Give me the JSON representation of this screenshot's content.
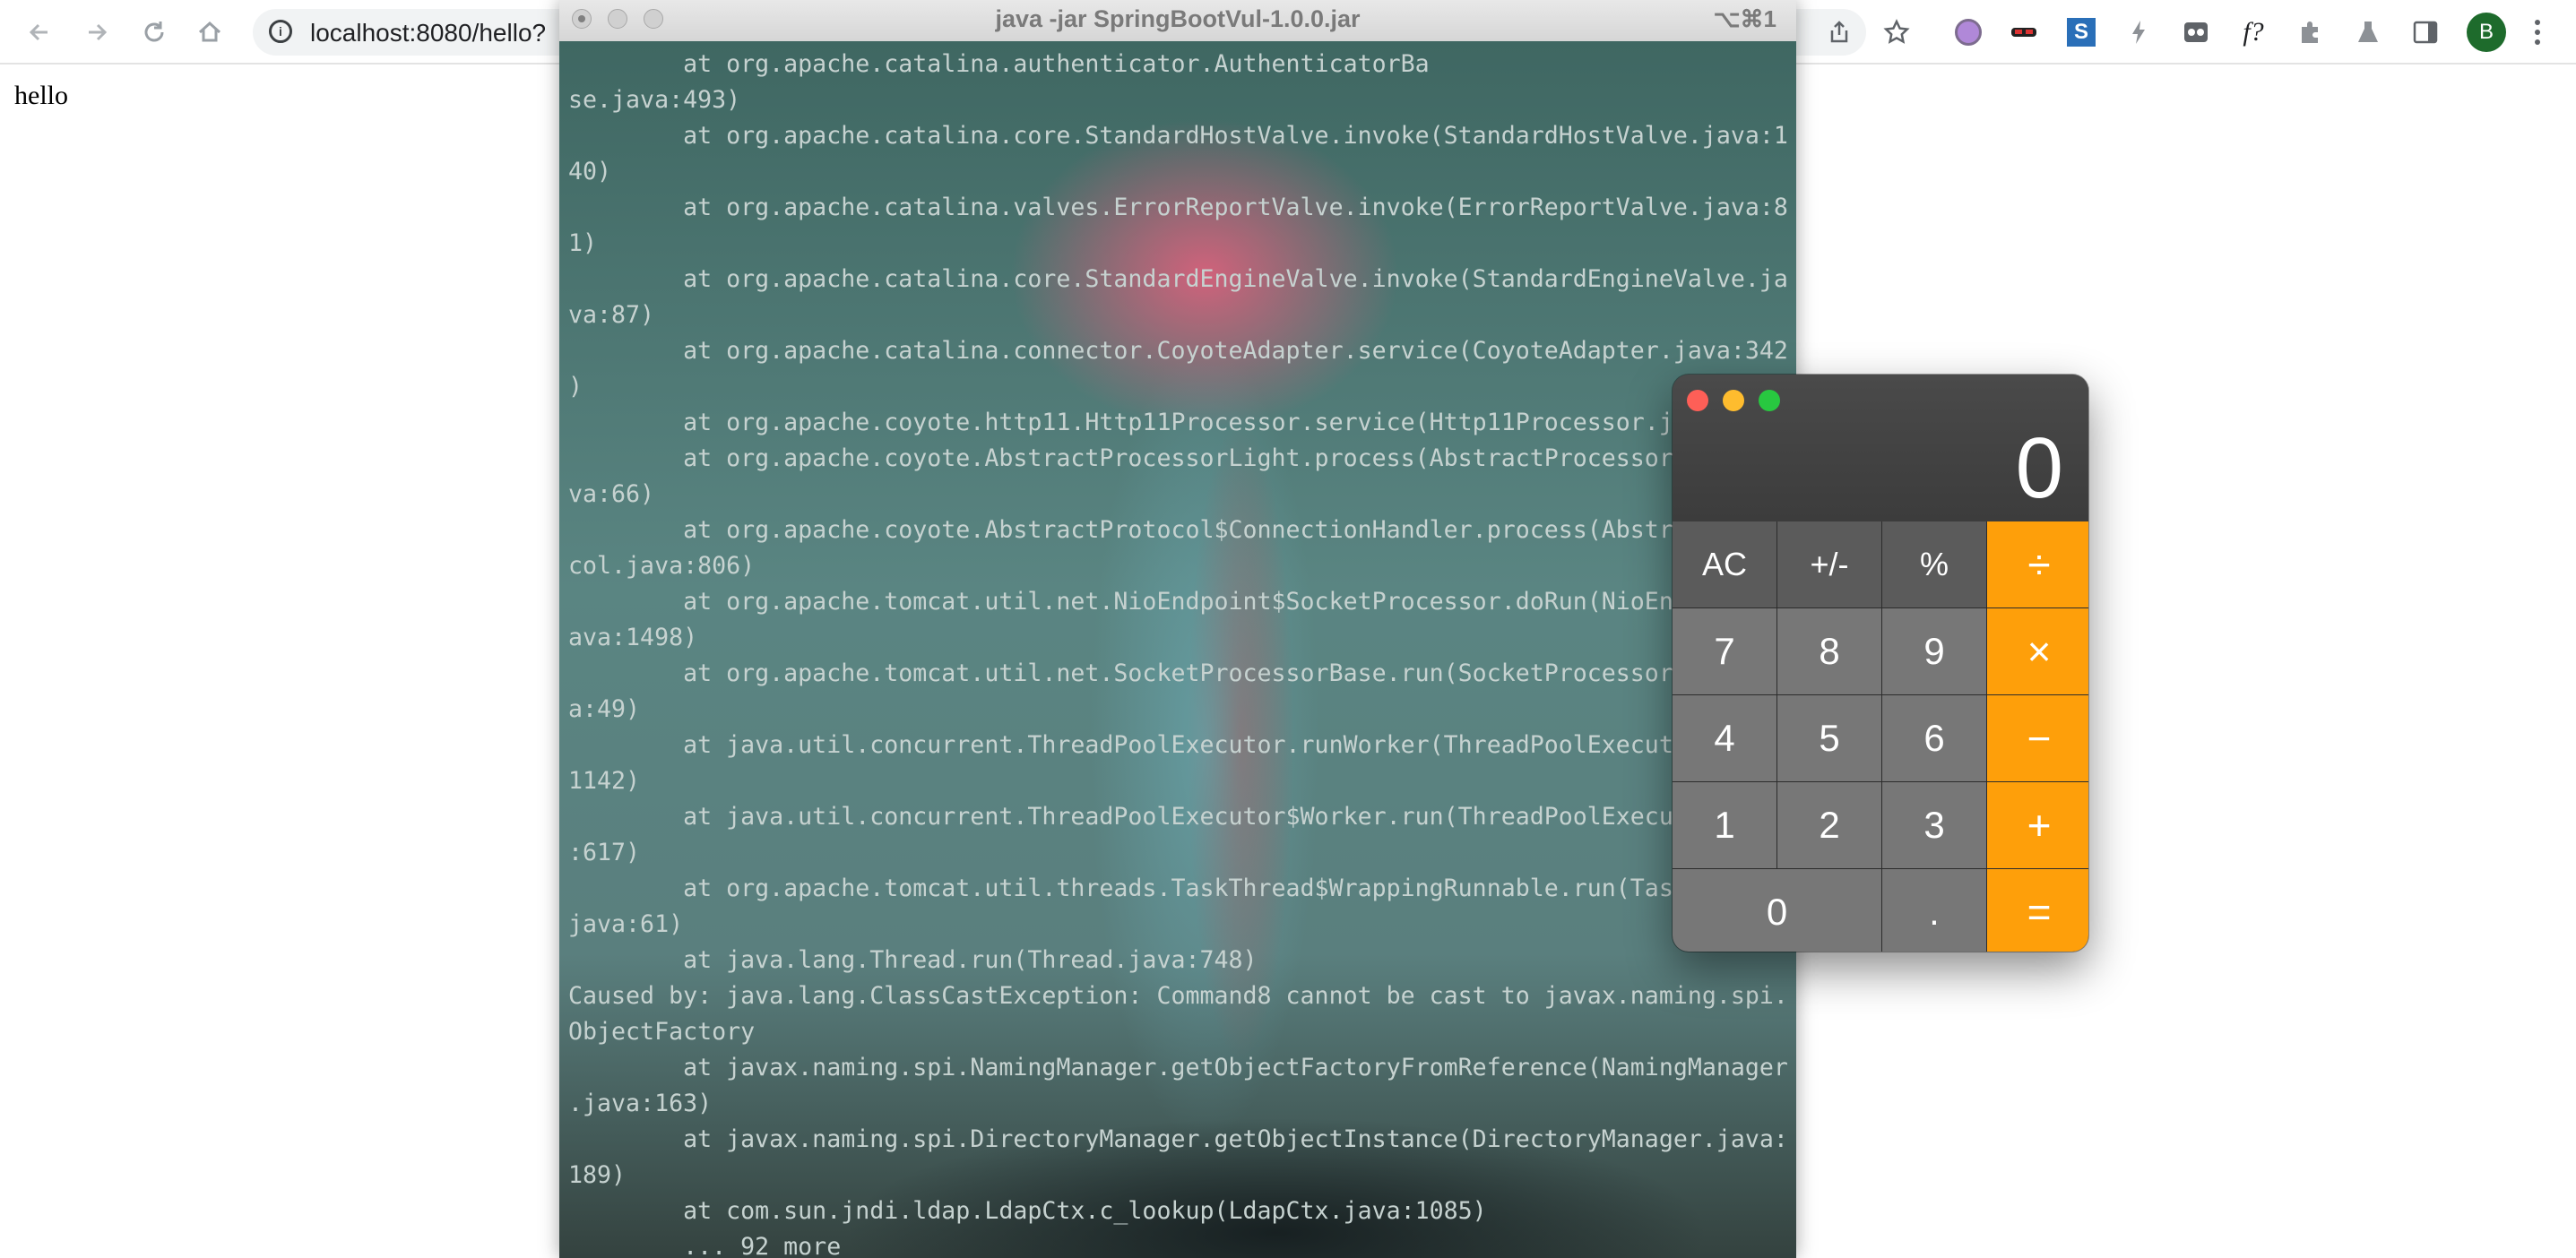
{
  "browser": {
    "url": "localhost:8080/hello?",
    "back_icon": "back-arrow",
    "forward_icon": "forward-arrow",
    "reload_icon": "reload",
    "home_icon": "home",
    "profile_initial": "B",
    "ext_f_label": "f?"
  },
  "page": {
    "text": "hello"
  },
  "terminal": {
    "title": "java -jar SpringBootVul-1.0.0.jar",
    "shortcut": "⌥⌘1",
    "lines": [
      "        at org.apache.catalina.authenticator.AuthenticatorBa",
      "se.java:493)",
      "        at org.apache.catalina.core.StandardHostValve.invoke(StandardHostValve.java:1",
      "40)",
      "        at org.apache.catalina.valves.ErrorReportValve.invoke(ErrorReportValve.java:8",
      "1)",
      "        at org.apache.catalina.core.StandardEngineValve.invoke(StandardEngineValve.ja",
      "va:87)",
      "        at org.apache.catalina.connector.CoyoteAdapter.service(CoyoteAdapter.java:342",
      ")",
      "        at org.apache.coyote.http11.Http11Processor.service(Http11Processor.j",
      "        at org.apache.coyote.AbstractProcessorLight.process(AbstractProcessor",
      "va:66)",
      "        at org.apache.coyote.AbstractProtocol$ConnectionHandler.process(Abstr",
      "col.java:806)",
      "        at org.apache.tomcat.util.net.NioEndpoint$SocketProcessor.doRun(NioEn",
      "ava:1498)",
      "        at org.apache.tomcat.util.net.SocketProcessorBase.run(SocketProcessor",
      "a:49)",
      "        at java.util.concurrent.ThreadPoolExecutor.runWorker(ThreadPoolExecut",
      "1142)",
      "        at java.util.concurrent.ThreadPoolExecutor$Worker.run(ThreadPoolExecu",
      ":617)",
      "        at org.apache.tomcat.util.threads.TaskThread$WrappingRunnable.run(Tas",
      "java:61)",
      "        at java.lang.Thread.run(Thread.java:748)",
      "Caused by: java.lang.ClassCastException: Command8 cannot be cast to javax.naming.spi.",
      "ObjectFactory",
      "        at javax.naming.spi.NamingManager.getObjectFactoryFromReference(NamingManager",
      ".java:163)",
      "        at javax.naming.spi.DirectoryManager.getObjectInstance(DirectoryManager.java:",
      "189)",
      "        at com.sun.jndi.ldap.LdapCtx.c_lookup(LdapCtx.java:1085)",
      "        ... 92 more"
    ]
  },
  "calculator": {
    "display": "0",
    "keys": [
      {
        "label": "AC",
        "kind": "fn",
        "name": "clear"
      },
      {
        "label": "+/-",
        "kind": "fn",
        "name": "sign"
      },
      {
        "label": "%",
        "kind": "fn",
        "name": "percent"
      },
      {
        "label": "÷",
        "kind": "op",
        "name": "divide"
      },
      {
        "label": "7",
        "kind": "num",
        "name": "7"
      },
      {
        "label": "8",
        "kind": "num",
        "name": "8"
      },
      {
        "label": "9",
        "kind": "num",
        "name": "9"
      },
      {
        "label": "×",
        "kind": "op",
        "name": "multiply"
      },
      {
        "label": "4",
        "kind": "num",
        "name": "4"
      },
      {
        "label": "5",
        "kind": "num",
        "name": "5"
      },
      {
        "label": "6",
        "kind": "num",
        "name": "6"
      },
      {
        "label": "−",
        "kind": "op",
        "name": "subtract"
      },
      {
        "label": "1",
        "kind": "num",
        "name": "1"
      },
      {
        "label": "2",
        "kind": "num",
        "name": "2"
      },
      {
        "label": "3",
        "kind": "num",
        "name": "3"
      },
      {
        "label": "+",
        "kind": "op",
        "name": "add"
      },
      {
        "label": "0",
        "kind": "num",
        "name": "0"
      },
      {
        "label": ".",
        "kind": "num",
        "name": "decimal"
      },
      {
        "label": "=",
        "kind": "op",
        "name": "equals"
      }
    ]
  },
  "colors": {
    "calc_operator": "#fe9f0a",
    "calc_function": "#5b5b5b",
    "calc_number": "#777777",
    "traffic_red": "#fe5f57",
    "traffic_yellow": "#febc2e",
    "traffic_green": "#28c840"
  }
}
